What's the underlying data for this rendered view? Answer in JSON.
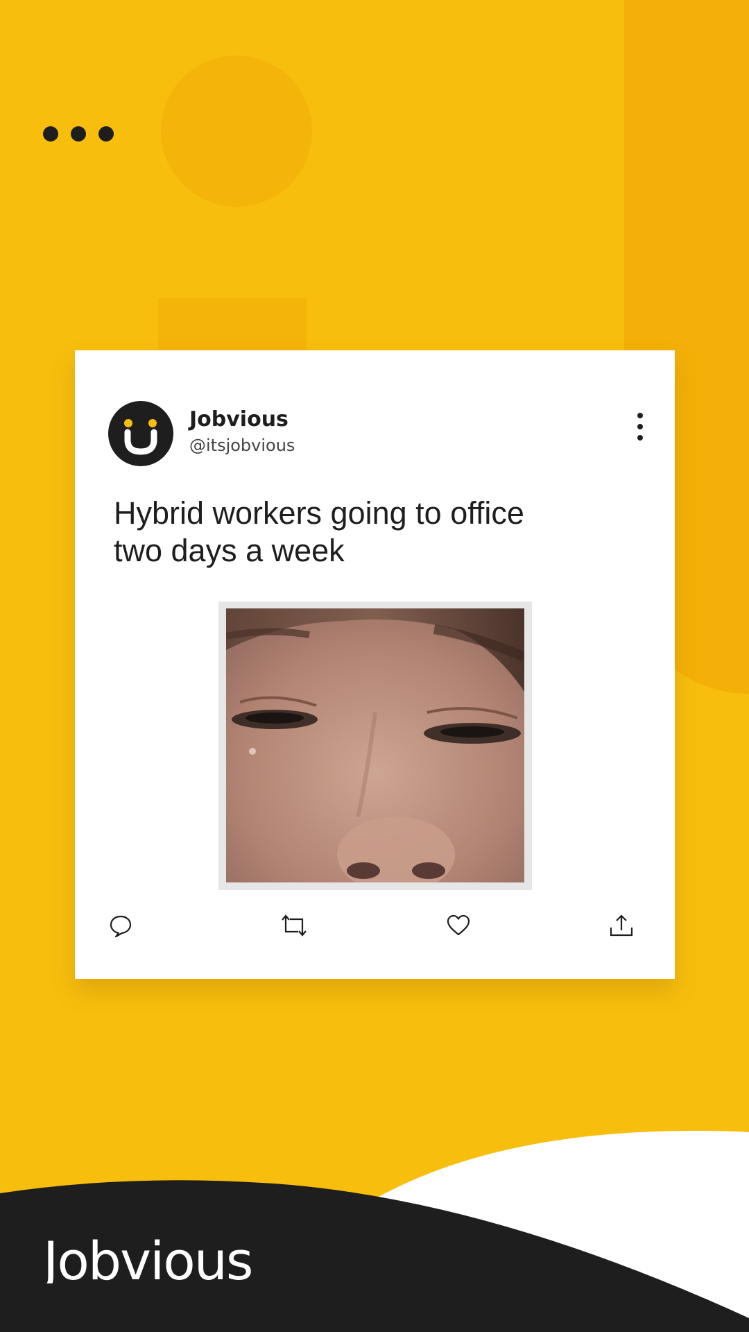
{
  "post": {
    "account_name": "Jobvious",
    "account_handle": "@itsjobvious",
    "text_line_1": "Hybrid workers going to office",
    "text_line_2": "two days a week",
    "avatar_icon": "jobvious-smiley-logo",
    "menu_icon": "more-vertical-icon",
    "media": "photo-close-up-crying-face"
  },
  "actions": [
    {
      "icon": "reply-icon"
    },
    {
      "icon": "retweet-icon"
    },
    {
      "icon": "like-icon"
    },
    {
      "icon": "share-icon"
    }
  ],
  "brand": {
    "logo_text": "Jobvious",
    "background_icon": "ellipsis-dots-icon"
  },
  "colors": {
    "background": "#F7BE0E",
    "accent": "#F4B008",
    "dark": "#1E1E1E",
    "card": "#FFFFFF"
  }
}
